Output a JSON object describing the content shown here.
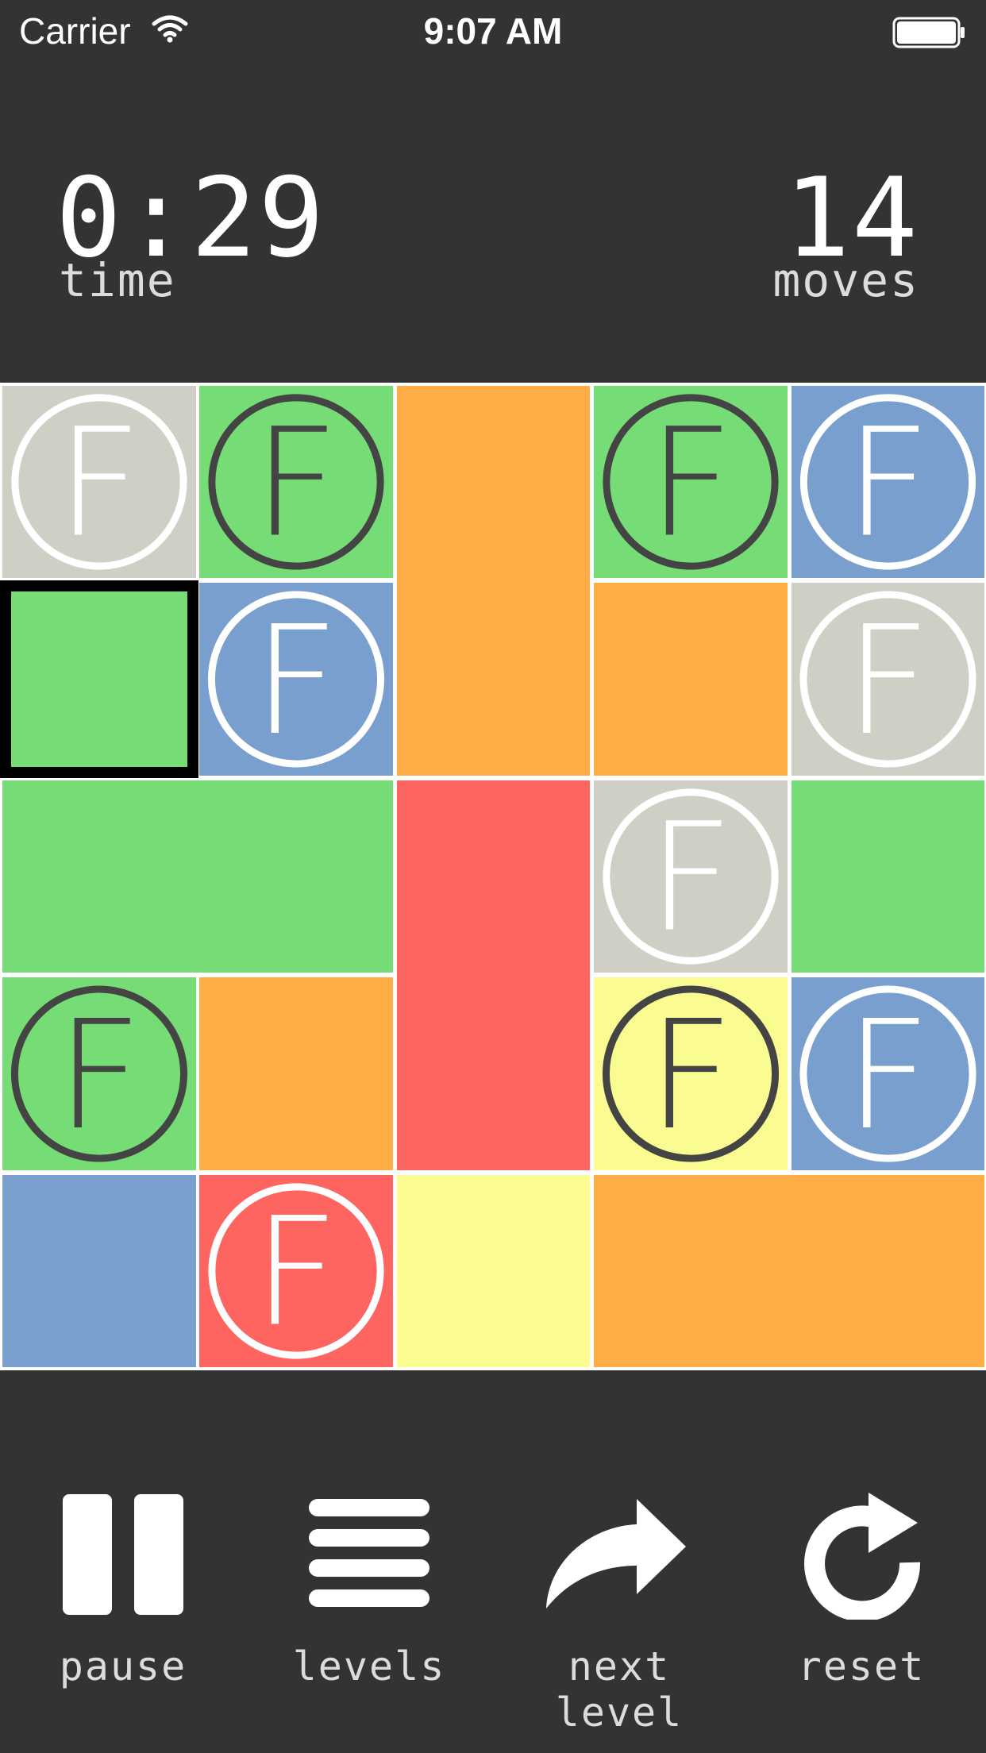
{
  "status_bar": {
    "carrier": "Carrier",
    "time": "9:07 AM"
  },
  "stats": {
    "time_value": "0:29",
    "time_label": "time",
    "moves_value": "14",
    "moves_label": "moves"
  },
  "colors": {
    "background": "#333333",
    "green": "#76dd76",
    "blue": "#789fcd",
    "gray": "#cfcfc6",
    "orange": "#fead47",
    "red": "#fe6561",
    "yellow": "#fafb91",
    "selected_outline": "#000000"
  },
  "board": {
    "tiles": [
      {
        "name": "tile-gray-emblem",
        "color": "gray",
        "emblem": "F",
        "emblem_color": "white"
      },
      {
        "name": "tile-green-emblem",
        "color": "green",
        "emblem": "F",
        "emblem_color": "dark"
      },
      {
        "name": "tile-orange-tall",
        "color": "orange"
      },
      {
        "name": "tile-green-emblem",
        "color": "green",
        "emblem": "F",
        "emblem_color": "dark"
      },
      {
        "name": "tile-blue-emblem",
        "color": "blue",
        "emblem": "F",
        "emblem_color": "white"
      },
      {
        "name": "tile-green-selected",
        "color": "green",
        "selected": true
      },
      {
        "name": "tile-blue-emblem",
        "color": "blue",
        "emblem": "F",
        "emblem_color": "white"
      },
      {
        "name": "tile-orange",
        "color": "orange"
      },
      {
        "name": "tile-gray-emblem",
        "color": "gray",
        "emblem": "F",
        "emblem_color": "white"
      },
      {
        "name": "tile-green-wide",
        "color": "green"
      },
      {
        "name": "tile-red-tall",
        "color": "red"
      },
      {
        "name": "tile-gray-emblem",
        "color": "gray",
        "emblem": "F",
        "emblem_color": "white"
      },
      {
        "name": "tile-green",
        "color": "green"
      },
      {
        "name": "tile-green-emblem",
        "color": "green",
        "emblem": "F",
        "emblem_color": "dark"
      },
      {
        "name": "tile-orange",
        "color": "orange"
      },
      {
        "name": "tile-yellow-emblem",
        "color": "yellow",
        "emblem": "F",
        "emblem_color": "dark"
      },
      {
        "name": "tile-blue-emblem",
        "color": "blue",
        "emblem": "F",
        "emblem_color": "white"
      },
      {
        "name": "tile-blue",
        "color": "blue"
      },
      {
        "name": "tile-red-emblem",
        "color": "red",
        "emblem": "F",
        "emblem_color": "white"
      },
      {
        "name": "tile-yellow",
        "color": "yellow"
      },
      {
        "name": "tile-orange-wide",
        "color": "orange"
      }
    ]
  },
  "controls": {
    "pause": "pause",
    "levels": "levels",
    "next_level": "next level",
    "reset": "reset"
  }
}
